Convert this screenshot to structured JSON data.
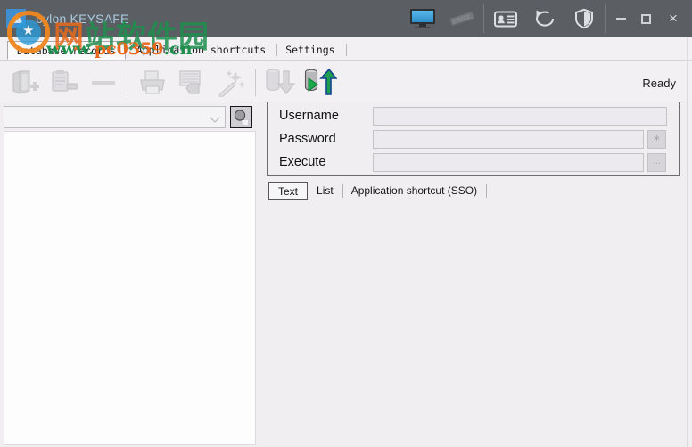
{
  "window": {
    "title": "bylon KEYSAFE",
    "controls": {
      "minimize": "minimize-button",
      "maximize": "maximize-button",
      "close": "×"
    },
    "icons": [
      {
        "name": "monitor-icon",
        "label": "Monitor"
      },
      {
        "name": "keyboard-icon",
        "label": "Keyboard"
      },
      {
        "name": "id-card-icon",
        "label": "ID card"
      },
      {
        "name": "refresh-icon",
        "label": "Refresh"
      },
      {
        "name": "shield-icon",
        "label": "Shield"
      }
    ]
  },
  "tabs": {
    "items": [
      {
        "label": "Database records",
        "active": true
      },
      {
        "label": "Application shortcuts",
        "active": false
      },
      {
        "label": "Settings",
        "active": false
      }
    ]
  },
  "toolbar": {
    "status": "Ready",
    "buttons": [
      {
        "name": "add-record-button",
        "label": "Add record",
        "enabled": false
      },
      {
        "name": "edit-record-button",
        "label": "Edit record",
        "enabled": false
      },
      {
        "name": "delete-record-button",
        "label": "Delete record",
        "enabled": false
      },
      {
        "name": "print-button",
        "label": "Print",
        "enabled": false
      },
      {
        "name": "save-button",
        "label": "Save",
        "enabled": false
      },
      {
        "name": "wizard-button",
        "label": "Wizard",
        "enabled": false
      },
      {
        "name": "import-button",
        "label": "Import",
        "enabled": false
      },
      {
        "name": "export-button",
        "label": "Export",
        "enabled": true
      }
    ]
  },
  "sidebar": {
    "search": {
      "value": "",
      "placeholder": "",
      "find_button": "find-button"
    },
    "list_items": []
  },
  "form": {
    "fields": [
      {
        "label": "Username",
        "value": "",
        "placeholder": "",
        "has_button": false
      },
      {
        "label": "Password",
        "value": "",
        "placeholder": "",
        "has_button": true,
        "button_glyph": "∗"
      },
      {
        "label": "Execute",
        "value": "",
        "placeholder": "",
        "has_button": true,
        "button_glyph": "..."
      }
    ]
  },
  "subtabs": {
    "items": [
      {
        "label": "Text",
        "active": true
      },
      {
        "label": "List",
        "active": false
      },
      {
        "label": "Application shortcut (SSO)",
        "active": false
      }
    ]
  },
  "watermark": {
    "cn_text_1": "网",
    "cn_text_2": "站软件园",
    "url_www": "www.",
    "url_name": "pc0359",
    "url_tld": ".cn"
  },
  "colors": {
    "titlebar": "#5b5e62",
    "accent_blue": "#3f8fd0",
    "panel": "#f0eef1",
    "list_bg": "#fdfdfe",
    "export_green": "#17a04a",
    "watermark_green": "#1e8f4e",
    "watermark_orange": "#e8691c"
  }
}
